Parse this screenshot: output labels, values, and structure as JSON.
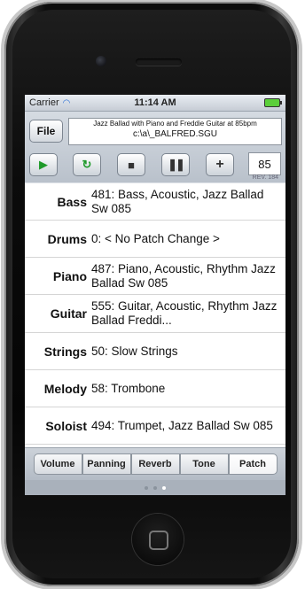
{
  "status": {
    "carrier": "Carrier",
    "time": "11:14 AM"
  },
  "header": {
    "file_label": "File",
    "title_line1": "Jazz Ballad with Piano and Freddie Guitar at 85bpm",
    "title_line2": "c:\\a\\_BALFRED.SGU",
    "tempo": "85",
    "rev": "REV. 184"
  },
  "rows": [
    {
      "label": "Bass",
      "value": "481: Bass, Acoustic, Jazz Ballad Sw 085"
    },
    {
      "label": "Drums",
      "value": "0: < No Patch Change >"
    },
    {
      "label": "Piano",
      "value": "487: Piano, Acoustic, Rhythm Jazz Ballad Sw 085"
    },
    {
      "label": "Guitar",
      "value": "555: Guitar, Acoustic, Rhythm Jazz Ballad Freddi..."
    },
    {
      "label": "Strings",
      "value": "50: Slow Strings"
    },
    {
      "label": "Melody",
      "value": "58: Trombone"
    },
    {
      "label": "Soloist",
      "value": "494: Trumpet, Jazz Ballad Sw 085"
    }
  ],
  "tabs": [
    "Volume",
    "Panning",
    "Reverb",
    "Tone",
    "Patch"
  ],
  "active_tab": "Patch",
  "icons": {
    "play": "play-icon",
    "loop": "loop-icon",
    "stop": "stop-icon",
    "pause": "pause-icon",
    "add": "plus-icon",
    "wifi": "wifi-icon",
    "battery": "battery-icon"
  },
  "colors": {
    "accent_green": "#1f9a2a",
    "battery": "#5bcf3a"
  }
}
